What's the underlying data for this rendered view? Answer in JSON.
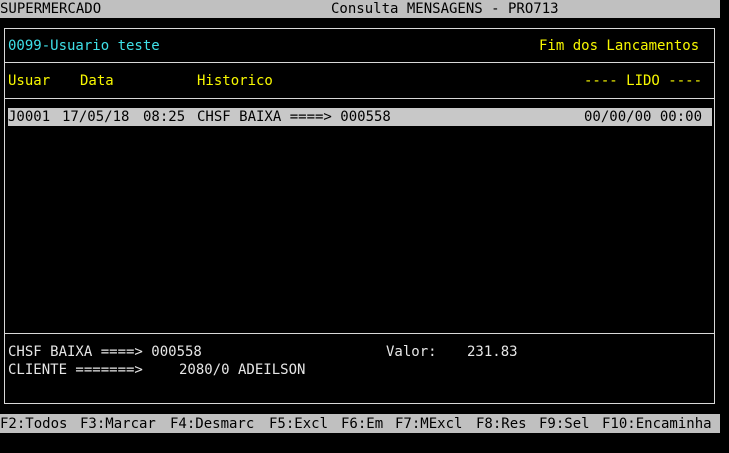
{
  "titlebar": {
    "app": "SUPERMERCADO",
    "title": "Consulta MENSAGENS - PRO713"
  },
  "header": {
    "user": "0099-Usuario teste",
    "status": "Fim dos Lancamentos"
  },
  "columns": {
    "usuar": "Usuar",
    "data": "Data",
    "historico": "Historico",
    "lido": "---- LIDO ----"
  },
  "rows": [
    {
      "usuar": "J0001",
      "date": "17/05/18",
      "time": "08:25",
      "historico": "CHSF BAIXA ====> 000558",
      "lido": "00/00/00 00:00"
    }
  ],
  "detail": {
    "line1": "CHSF BAIXA ====> 000558",
    "valor_label": "Valor:",
    "valor": "231.83",
    "cliente_label": "CLIENTE =======>",
    "cliente": "2080/0 ADEILSON"
  },
  "fkeys": [
    "F2:Todos",
    "F3:Marcar",
    "F4:Desmarc",
    "F5:Excl",
    "F6:Em",
    "F7:MExcl",
    "F8:Res",
    "F9:Sel",
    "F10:Encaminha"
  ]
}
